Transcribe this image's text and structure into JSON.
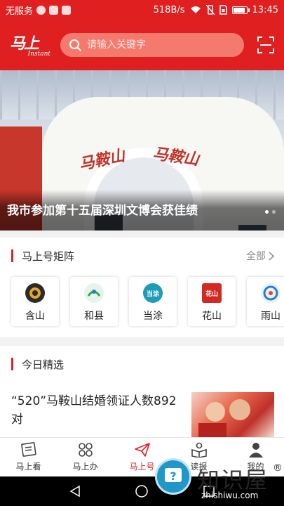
{
  "status_bar": {
    "carrier": "无服务",
    "net_speed": "518B/s",
    "time": "13:45",
    "icons": [
      "moon-icon",
      "app-icon",
      "gallery-icon",
      "wifi-icon",
      "vibrate-off-icon",
      "sim-icon",
      "battery-icon"
    ]
  },
  "header": {
    "logo_text": "马上",
    "logo_sub": "Instant",
    "search_placeholder": "请输入关键字",
    "scan_icon": "scan-icon"
  },
  "banner": {
    "title": "我市参加第十五届深圳文博会获佳绩",
    "page_count": 2,
    "active_index": 0
  },
  "matrix_section": {
    "title": "马上号矩阵",
    "more_label": "全部",
    "items": [
      {
        "name": "含山",
        "logo_color": "#2b2b2b",
        "logo_text": ""
      },
      {
        "name": "和县",
        "logo_color": "#3aa84a",
        "logo_text": ""
      },
      {
        "name": "当涂",
        "logo_color": "#1f9bb8",
        "logo_text": "当涂"
      },
      {
        "name": "花山",
        "logo_color": "#d22a22",
        "logo_text": "花山"
      },
      {
        "name": "雨山",
        "logo_color": "#2c7fc4",
        "logo_text": ""
      }
    ]
  },
  "today_section": {
    "title": "今日精选",
    "articles": [
      {
        "title": "“520”马鞍山结婚领证人数892对"
      }
    ]
  },
  "bottom_nav": {
    "items": [
      {
        "label": "马上看",
        "icon": "newspaper-icon"
      },
      {
        "label": "马上办",
        "icon": "apps-grid-icon"
      },
      {
        "label": "马上号",
        "icon": "paper-plane-icon"
      },
      {
        "label": "读报",
        "icon": "reader-icon"
      },
      {
        "label": "我的",
        "icon": "user-icon"
      }
    ],
    "active_index": 2,
    "active_color": "#e02020"
  },
  "watermark": {
    "name": "知识屋",
    "url": "zhishiwu.com",
    "reg": "®"
  },
  "colors": {
    "brand_red": "#e02020",
    "search_bg": "#f57a6e"
  }
}
